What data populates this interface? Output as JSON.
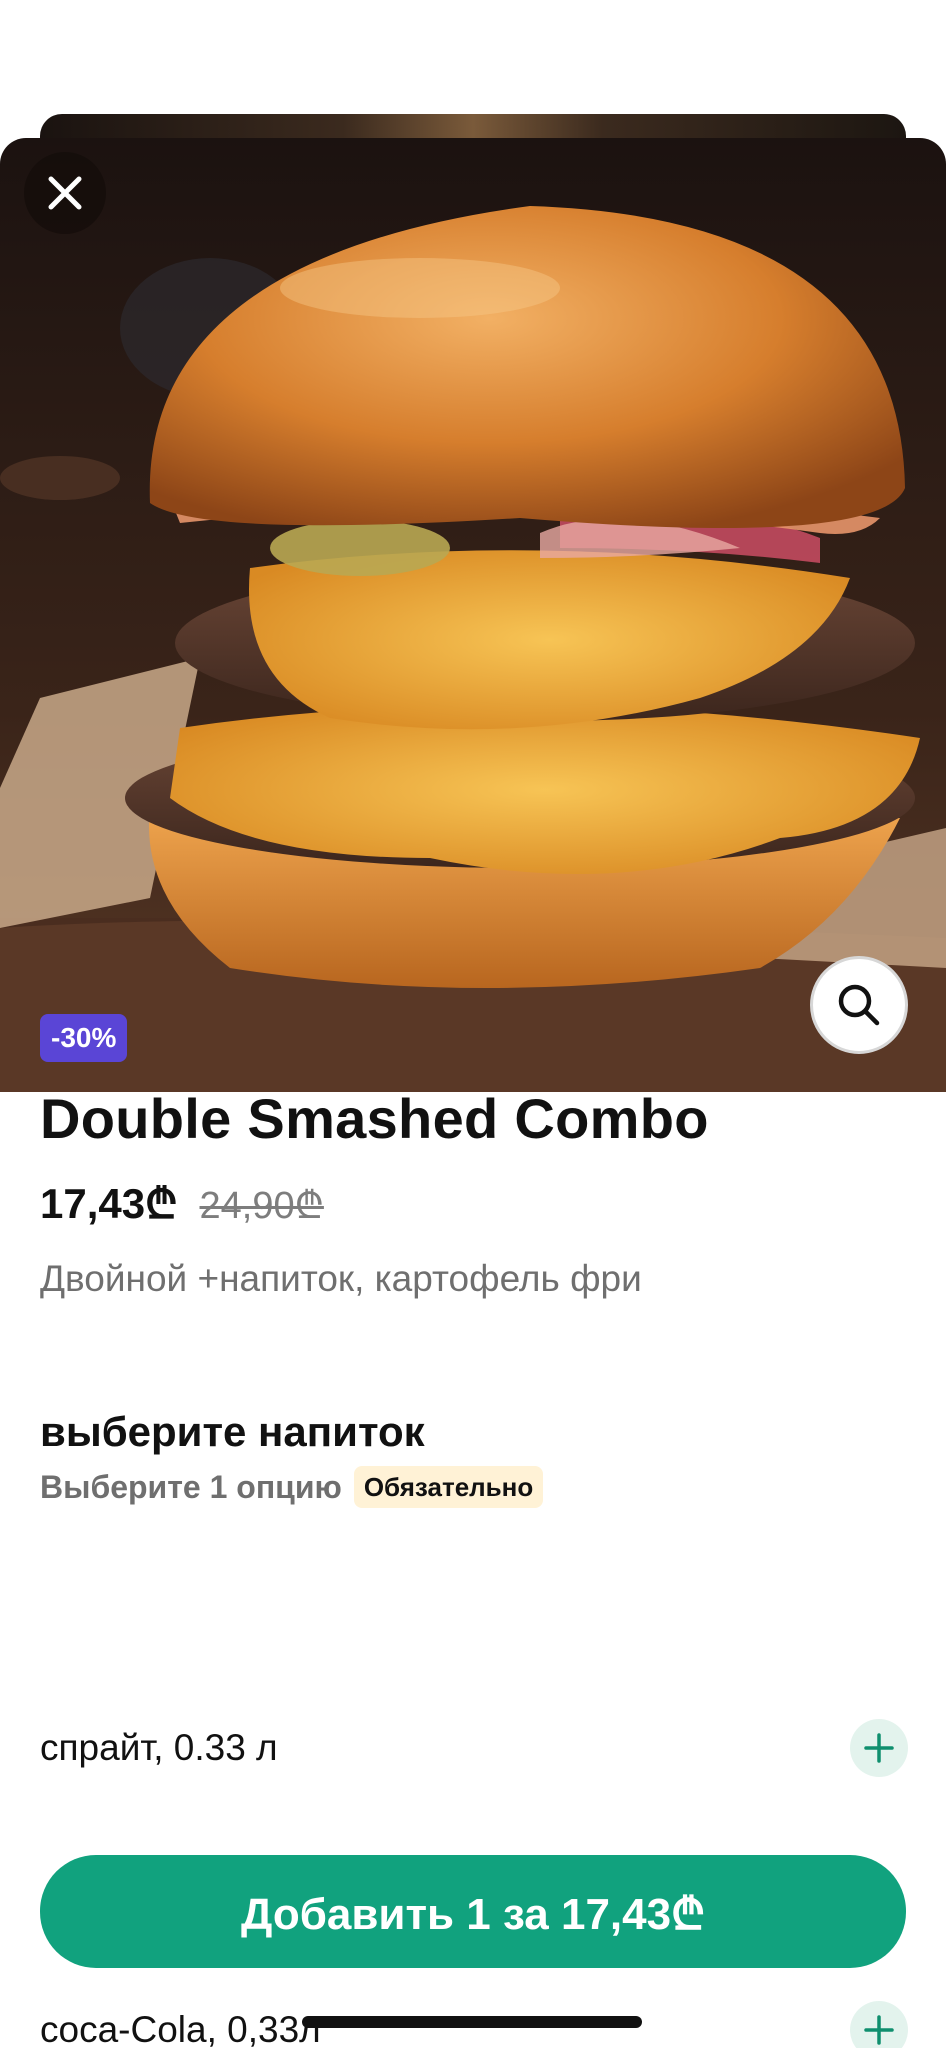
{
  "product": {
    "discount_badge": "-30%",
    "title": "Double Smashed Combo",
    "price": "17,43₾",
    "old_price": "24,90₾",
    "description": "Двойной +напиток, картофель  фри"
  },
  "drink_section": {
    "title": "выберите напиток",
    "subtitle": "Выберите 1 опцию",
    "required_badge": "Обязательно",
    "options": [
      {
        "label": "спрайт, 0.33 л"
      },
      {
        "label": "coca-Cola, 0,33л"
      }
    ]
  },
  "cart": {
    "add_button_label": "Добавить 1 за 17,43₾"
  },
  "colors": {
    "accent_green": "#11a27e",
    "discount_purple": "#5a45d6",
    "required_badge_bg": "#fff2d6"
  },
  "icons": {
    "close": "close-icon",
    "zoom": "search-icon",
    "add_option": "plus-icon"
  }
}
